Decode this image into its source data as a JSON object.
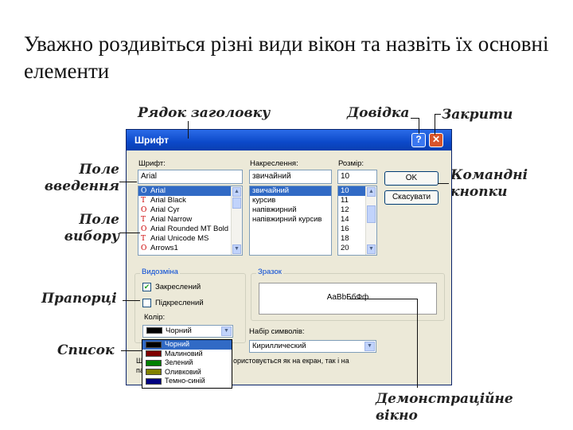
{
  "slide_title": "Уважно роздивіться різні види вікон та назвіть їх основні елементи",
  "callouts": {
    "title_bar": "Рядок заголовку",
    "help": "Довідка",
    "close": "Закрити",
    "input_field": "Поле введення",
    "command_buttons": "Командні кнопки",
    "selection_field": "Поле вибору",
    "checkboxes": "Прапорці",
    "list": "Список",
    "preview_window": "Демонстраційне вікно"
  },
  "dialog": {
    "title": "Шрифт",
    "help_button": "?",
    "close_button": "✕",
    "font": {
      "label": "Шрифт:",
      "value": "Arial",
      "items": [
        "Arial",
        "Arial Black",
        "Arial Cyr",
        "Arial Narrow",
        "Arial Rounded MT Bold",
        "Arial Unicode MS",
        "Arrows1"
      ],
      "selected_index": 0
    },
    "style": {
      "label": "Накреслення:",
      "value": "звичайний",
      "items": [
        "звичайний",
        "курсив",
        "напівжирний",
        "напівжирний курсив"
      ],
      "selected_index": 0
    },
    "size": {
      "label": "Розмір:",
      "value": "10",
      "items": [
        "10",
        "11",
        "12",
        "14",
        "16",
        "18",
        "20"
      ],
      "selected_index": 0
    },
    "ok_button": "OK",
    "cancel_button": "Скасувати",
    "effects": {
      "label": "Видозміна",
      "strikeout": {
        "label": "Закреслений",
        "checked": true
      },
      "underline": {
        "label": "Підкреслений",
        "checked": false
      },
      "color_label": "Колір:",
      "color_value": "Чорний",
      "color_swatch": "#000000"
    },
    "sample": {
      "label": "Зразок",
      "text": "AaBbБбФф"
    },
    "charset": {
      "label": "Набір символів:",
      "value": "Кириллический"
    },
    "color_list": [
      {
        "name": "Чорний",
        "color": "#000000",
        "selected": true
      },
      {
        "name": "Малиновий",
        "color": "#800000",
        "selected": false
      },
      {
        "name": "Зелений",
        "color": "#008000",
        "selected": false
      },
      {
        "name": "Оливковий",
        "color": "#808000",
        "selected": false
      },
      {
        "name": "Темно-синій",
        "color": "#000080",
        "selected": false
      }
    ],
    "note_left": "Ш",
    "note_left2": "па",
    "note_right": "ористовується як на екран, так і на"
  }
}
